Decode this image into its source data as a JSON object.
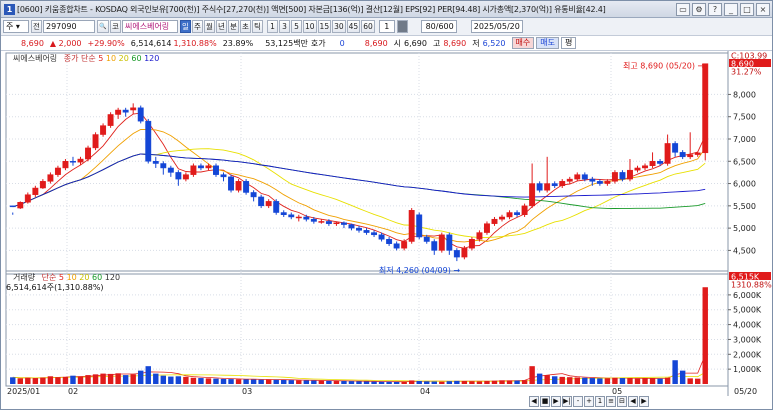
{
  "window": {
    "number": "1",
    "title": "[0600] 키움종합차트 - KOSDAQ 외국인보유[700(천)] 주식수[27,270(천)] 액면[500] 자본금[136(억)] 결산[12월] EPS[92] PER[94.48] 시가총액[2,370(억)] 유통비율[42.4]",
    "buttons": [
      "▭",
      "⚙",
      "?",
      "_",
      "□",
      "×"
    ]
  },
  "toolbar1": {
    "market": "주",
    "market_arrow": "▾",
    "scope": "전",
    "code": "297090",
    "search_glyph": "🔍",
    "prefix": "코",
    "stock_name": "씨에스베어링",
    "periods": [
      "일",
      "주",
      "월",
      "년",
      "분",
      "초",
      "틱"
    ],
    "active_period": "일",
    "minute_steps": [
      "1",
      "3",
      "5",
      "10",
      "15",
      "30",
      "45",
      "60"
    ],
    "count_value": "1",
    "range_value": "80/600",
    "date_value": "2025/05/20"
  },
  "quote": {
    "price": "8,690",
    "change": "▲ 2,000",
    "change_pct": "+29.90%",
    "volume": "6,514,614",
    "vol_ratio": "1,310.88%",
    "turnover": "23.89%",
    "amount": "53,125백만",
    "hoga_label": "호가",
    "hoga_value": "0",
    "current": "8,690",
    "open_label": "시",
    "open": "6,690",
    "high_label": "고",
    "high": "8,690",
    "low_label": "저",
    "low": "6,520",
    "buy": "매수",
    "sell": "매도",
    "flat": "평"
  },
  "price_legend": {
    "name": "씨에스베어링",
    "ma_label": "종가 단순",
    "ma": [
      "5",
      "10",
      "20",
      "60",
      "120"
    ]
  },
  "volume_legend": {
    "name": "거래량",
    "ma_label": "단순",
    "ma": [
      "5",
      "10",
      "20",
      "60",
      "120"
    ],
    "value": "6,514,614주(1,310.88%)"
  },
  "chart_data": {
    "type": "candlestick",
    "x_labels": [
      "2025/01",
      "02",
      "03",
      "04",
      "05"
    ],
    "y_ticks": [
      "4,500",
      "5,000",
      "5,500",
      "6,000",
      "6,500",
      "7,000",
      "7,500",
      "8,000"
    ],
    "y_range": [
      4150,
      8750
    ],
    "badges": {
      "top": "103.99",
      "price": "8,690",
      "price_pct": "31.27%",
      "vol": "6,515K",
      "vol_pct": "1310.88%",
      "date": "05/20"
    },
    "annotations": {
      "high": "최고 8,690 (05/20)",
      "low": "최저 4,260 (04/09)"
    },
    "vol_ticks": [
      "1,000K",
      "2,000K",
      "3,000K",
      "4,000K",
      "5,000K",
      "6,000K"
    ],
    "vol_range": [
      0,
      6800
    ],
    "colors": {
      "up": "#e01b1b",
      "down": "#1446d6",
      "ma5": "#e0231c",
      "ma10": "#f0a000",
      "ma20": "#e8e000",
      "ma60": "#1a9a2a",
      "ma120": "#1a1acc"
    },
    "candles": [
      [
        5500,
        5480,
        5350,
        5300
      ],
      [
        5450,
        5580,
        5600,
        5430
      ],
      [
        5580,
        5750,
        5800,
        5550
      ],
      [
        5750,
        5900,
        5950,
        5700
      ],
      [
        5900,
        6050,
        6100,
        5880
      ],
      [
        6050,
        6200,
        6250,
        6000
      ],
      [
        6200,
        6350,
        6400,
        6150
      ],
      [
        6350,
        6500,
        6550,
        6300
      ],
      [
        6500,
        6480,
        6600,
        6400
      ],
      [
        6480,
        6550,
        6600,
        6420
      ],
      [
        6550,
        6800,
        6850,
        6500
      ],
      [
        6800,
        7100,
        7150,
        6750
      ],
      [
        7100,
        7300,
        7350,
        7050
      ],
      [
        7300,
        7550,
        7600,
        7250
      ],
      [
        7550,
        7650,
        7700,
        7450
      ],
      [
        7650,
        7600,
        7700,
        7500
      ],
      [
        7650,
        7700,
        7800,
        7550
      ],
      [
        7700,
        7400,
        7750,
        7350
      ],
      [
        7400,
        6500,
        7450,
        6450
      ],
      [
        6500,
        6450,
        6600,
        6350
      ],
      [
        6450,
        6350,
        6500,
        6200
      ],
      [
        6350,
        6250,
        6400,
        6150
      ],
      [
        6250,
        6100,
        6300,
        5950
      ],
      [
        6100,
        6200,
        6250,
        6050
      ],
      [
        6200,
        6400,
        6450,
        6150
      ],
      [
        6400,
        6350,
        6450,
        6300
      ],
      [
        6350,
        6400,
        6450,
        6300
      ],
      [
        6400,
        6200,
        6450,
        6150
      ],
      [
        6200,
        6150,
        6250,
        6050
      ],
      [
        6150,
        5850,
        6200,
        5800
      ],
      [
        5850,
        6050,
        6100,
        5800
      ],
      [
        6050,
        5800,
        6100,
        5750
      ],
      [
        5800,
        5700,
        5850,
        5600
      ],
      [
        5700,
        5500,
        5750,
        5450
      ],
      [
        5500,
        5600,
        5650,
        5450
      ],
      [
        5600,
        5350,
        5650,
        5300
      ],
      [
        5350,
        5300,
        5400,
        5250
      ],
      [
        5300,
        5250,
        5350,
        5200
      ],
      [
        5250,
        5250,
        5300,
        5150
      ],
      [
        5250,
        5200,
        5300,
        5150
      ],
      [
        5200,
        5150,
        5250,
        5100
      ],
      [
        5150,
        5150,
        5200,
        5100
      ],
      [
        5150,
        5100,
        5200,
        5050
      ],
      [
        5100,
        5120,
        5150,
        5050
      ],
      [
        5120,
        5080,
        5150,
        5000
      ],
      [
        5080,
        5000,
        5100,
        4950
      ],
      [
        5000,
        4950,
        5050,
        4900
      ],
      [
        4950,
        4900,
        5000,
        4850
      ],
      [
        4900,
        4850,
        4950,
        4800
      ],
      [
        4850,
        4750,
        4900,
        4700
      ],
      [
        4750,
        4650,
        4800,
        4600
      ],
      [
        4650,
        4550,
        4700,
        4500
      ],
      [
        4550,
        4700,
        4750,
        4500
      ],
      [
        4700,
        5400,
        5450,
        4650
      ],
      [
        5300,
        4800,
        5350,
        4750
      ],
      [
        4800,
        4700,
        4850,
        4650
      ],
      [
        4700,
        4500,
        4750,
        4400
      ],
      [
        4500,
        4850,
        4900,
        4450
      ],
      [
        4850,
        4500,
        4900,
        4400
      ],
      [
        4500,
        4350,
        4550,
        4260
      ],
      [
        4350,
        4550,
        4600,
        4300
      ],
      [
        4550,
        4750,
        4800,
        4500
      ],
      [
        4750,
        4900,
        4950,
        4700
      ],
      [
        4900,
        5100,
        5150,
        4850
      ],
      [
        5100,
        5200,
        5250,
        5050
      ],
      [
        5200,
        5250,
        5300,
        5150
      ],
      [
        5250,
        5350,
        5400,
        5200
      ],
      [
        5350,
        5300,
        5400,
        5250
      ],
      [
        5300,
        5500,
        5550,
        5250
      ],
      [
        5500,
        6000,
        6450,
        5450
      ],
      [
        6000,
        5850,
        6050,
        5800
      ],
      [
        5850,
        6000,
        6600,
        5800
      ],
      [
        6000,
        5950,
        6050,
        5900
      ],
      [
        5950,
        6050,
        6100,
        5900
      ],
      [
        6050,
        6100,
        6150,
        6000
      ],
      [
        6100,
        6200,
        6250,
        6050
      ],
      [
        6200,
        6100,
        6250,
        6050
      ],
      [
        6100,
        6050,
        6150,
        5950
      ],
      [
        6050,
        6000,
        6100,
        5950
      ],
      [
        6000,
        6050,
        6100,
        5950
      ],
      [
        6050,
        6250,
        6300,
        6000
      ],
      [
        6250,
        6100,
        6300,
        6050
      ],
      [
        6100,
        6300,
        6550,
        6050
      ],
      [
        6300,
        6350,
        6400,
        6250
      ],
      [
        6350,
        6400,
        6450,
        6300
      ],
      [
        6400,
        6500,
        6700,
        6350
      ],
      [
        6500,
        6450,
        6550,
        6400
      ],
      [
        6450,
        6900,
        7100,
        6400
      ],
      [
        6900,
        6700,
        6950,
        6600
      ],
      [
        6700,
        6600,
        6750,
        6550
      ],
      [
        6600,
        6650,
        7150,
        6550
      ],
      [
        6650,
        6690,
        6700,
        6600
      ],
      [
        6690,
        8690,
        8690,
        6520
      ]
    ],
    "volumes": [
      450,
      380,
      420,
      400,
      430,
      520,
      460,
      480,
      560,
      500,
      600,
      650,
      700,
      680,
      720,
      600,
      650,
      900,
      1200,
      700,
      560,
      500,
      520,
      480,
      420,
      400,
      380,
      360,
      340,
      330,
      320,
      310,
      300,
      290,
      300,
      280,
      270,
      260,
      250,
      240,
      230,
      220,
      210,
      200,
      200,
      190,
      180,
      170,
      160,
      150,
      150,
      140,
      160,
      240,
      200,
      180,
      170,
      160,
      190,
      210,
      200,
      190,
      180,
      200,
      220,
      250,
      240,
      230,
      260,
      1200,
      700,
      600,
      520,
      480,
      460,
      440,
      420,
      400,
      380,
      390,
      420,
      400,
      380,
      360,
      370,
      380,
      360,
      420,
      1600,
      900,
      380,
      360,
      6515
    ]
  },
  "bottom_buttons": [
    "◀",
    "■",
    "▶",
    "▶|",
    "-",
    "+",
    "1",
    "≡",
    "⊟",
    "◀",
    "▶"
  ]
}
